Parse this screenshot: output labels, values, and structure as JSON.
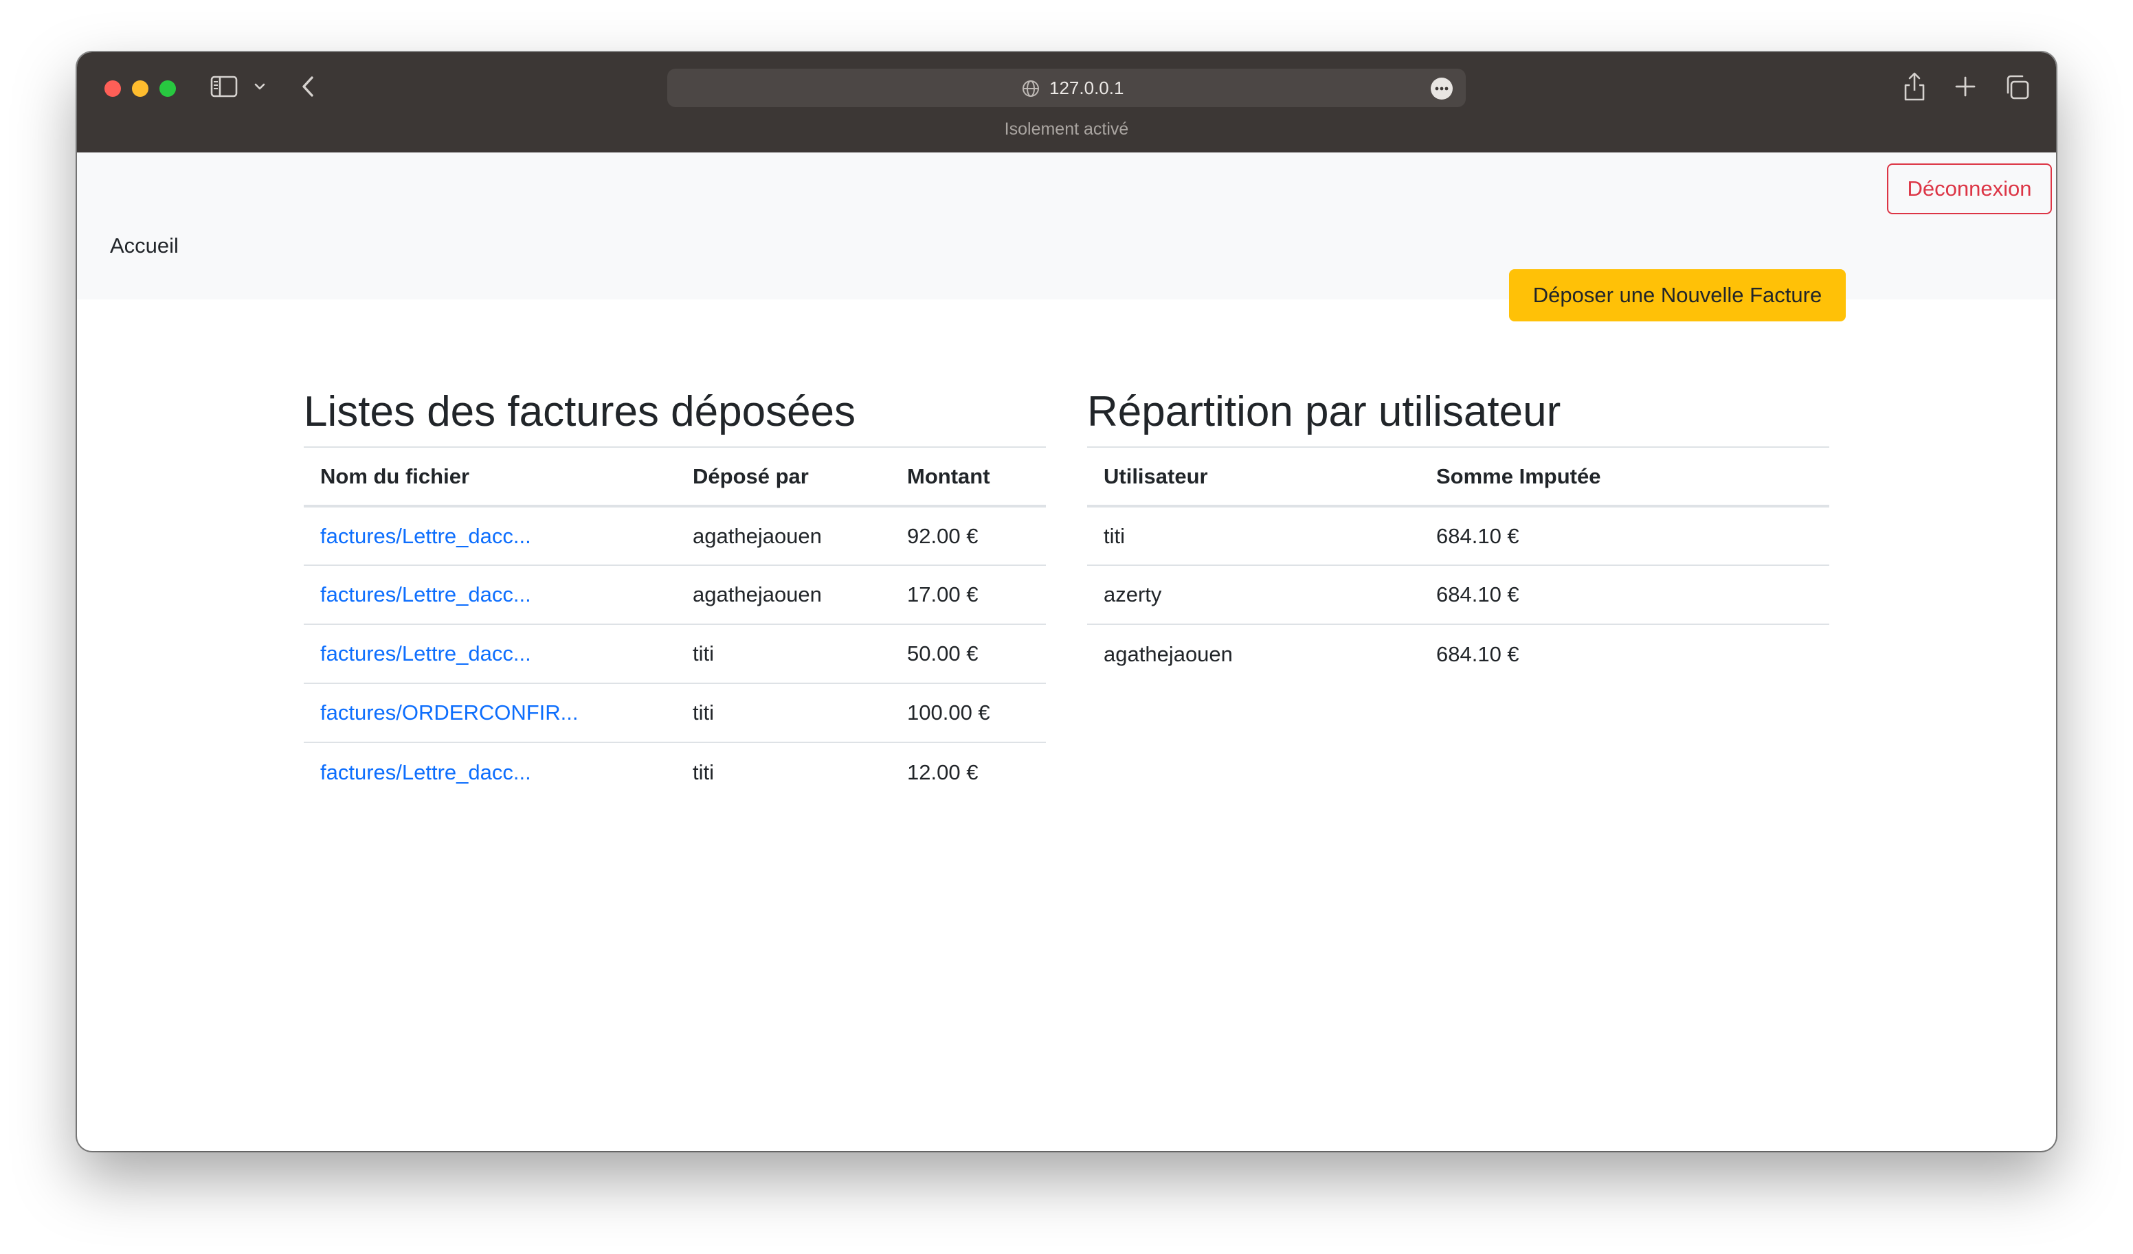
{
  "browser": {
    "url": "127.0.0.1",
    "isolation_text": "Isolement activé"
  },
  "nav": {
    "brand": "Accueil",
    "logout_label": "Déconnexion"
  },
  "actions": {
    "new_invoice_label": "Déposer une Nouvelle Facture"
  },
  "invoices": {
    "title": "Listes des factures déposées",
    "headers": [
      "Nom du fichier",
      "Déposé par",
      "Montant"
    ],
    "rows": [
      {
        "file": "factures/Lettre_dacc...",
        "by": "agathejaouen",
        "amount": "92.00 €"
      },
      {
        "file": "factures/Lettre_dacc...",
        "by": "agathejaouen",
        "amount": "17.00 €"
      },
      {
        "file": "factures/Lettre_dacc...",
        "by": "titi",
        "amount": "50.00 €"
      },
      {
        "file": "factures/ORDERCONFIR...",
        "by": "titi",
        "amount": "100.00 €"
      },
      {
        "file": "factures/Lettre_dacc...",
        "by": "titi",
        "amount": "12.00 €"
      }
    ]
  },
  "distribution": {
    "title": "Répartition par utilisateur",
    "headers": [
      "Utilisateur",
      "Somme Imputée"
    ],
    "rows": [
      {
        "user": "titi",
        "sum": "684.10 €"
      },
      {
        "user": "azerty",
        "sum": "684.10 €"
      },
      {
        "user": "agathejaouen",
        "sum": "684.10 €"
      }
    ]
  }
}
